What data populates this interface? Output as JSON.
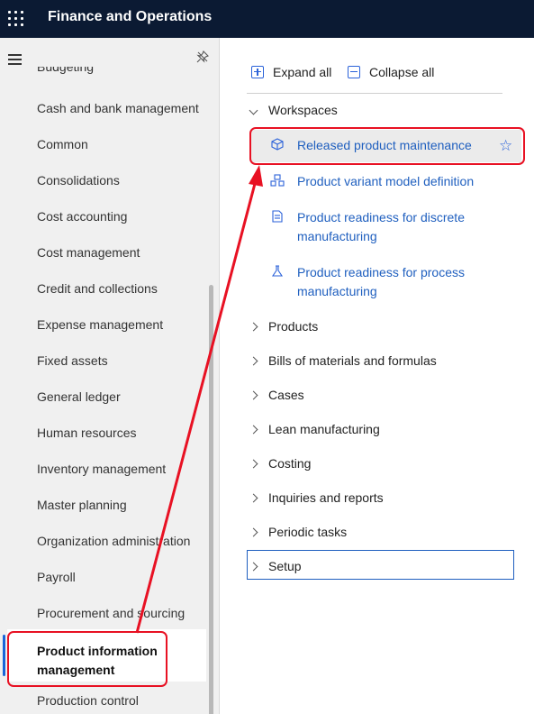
{
  "app": {
    "title": "Finance and Operations",
    "waffle_icon": "app-launcher-icon"
  },
  "sidebar": {
    "clipped_top_item": "Budgeting",
    "items": [
      "Cash and bank management",
      "Common",
      "Consolidations",
      "Cost accounting",
      "Cost management",
      "Credit and collections",
      "Expense management",
      "Fixed assets",
      "General ledger",
      "Human resources",
      "Inventory management",
      "Master planning",
      "Organization administration",
      "Payroll",
      "Procurement and sourcing"
    ],
    "active_item": "Product information management",
    "after_active": "Production control",
    "accent_color": "#1a64d8"
  },
  "toolbar": {
    "expand_label": "Expand all",
    "collapse_label": "Collapse all"
  },
  "workspaces": {
    "label": "Workspaces",
    "items": [
      {
        "label": "Released product maintenance",
        "icon": "cube-icon",
        "favorite_icon": "star-icon"
      },
      {
        "label": "Product variant model definition",
        "icon": "variant-model-icon"
      },
      {
        "label": "Product readiness for discrete manufacturing",
        "icon": "discrete-readiness-icon"
      },
      {
        "label": "Product readiness for process manufacturing",
        "icon": "process-readiness-icon"
      }
    ]
  },
  "groups": [
    "Products",
    "Bills of materials and formulas",
    "Cases",
    "Lean manufacturing",
    "Costing",
    "Inquiries and reports",
    "Periodic tasks",
    "Setup"
  ],
  "colors": {
    "topbar": "#0b1a33",
    "link": "#1f5fbf",
    "callout": "#e81123"
  }
}
